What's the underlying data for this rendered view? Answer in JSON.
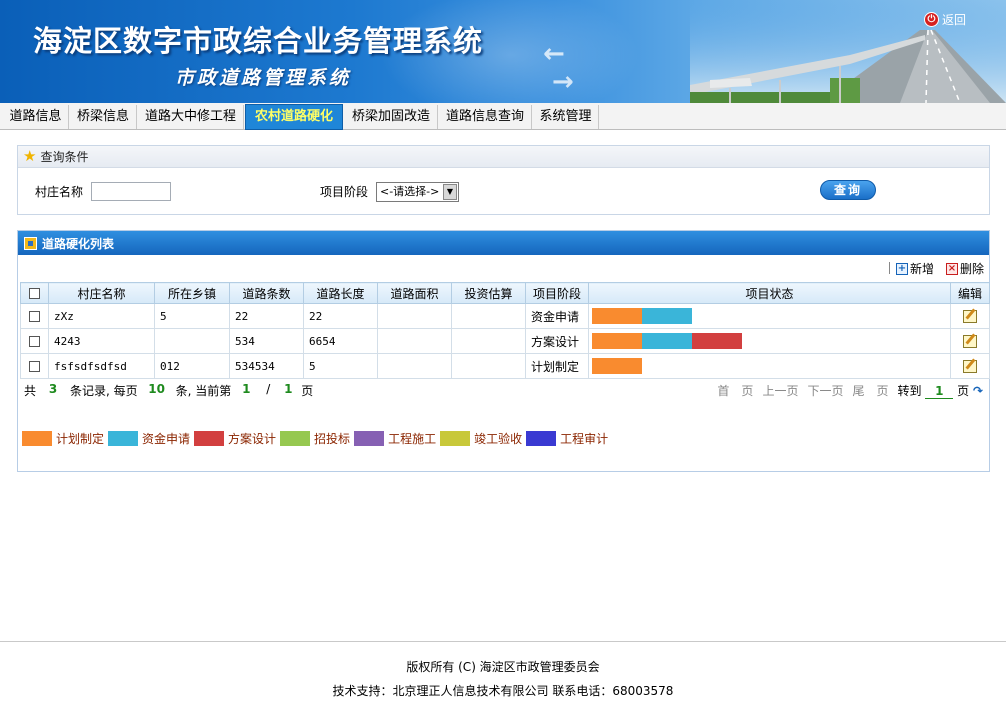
{
  "header": {
    "title": "海淀区数字市政综合业务管理系统",
    "subtitle": "市政道路管理系统",
    "logout_label": "返回"
  },
  "nav": {
    "tabs": [
      {
        "label": "道路信息"
      },
      {
        "label": "桥梁信息"
      },
      {
        "label": "道路大中修工程"
      },
      {
        "label": "农村道路硬化",
        "active": true
      },
      {
        "label": "桥梁加固改造"
      },
      {
        "label": "道路信息查询"
      },
      {
        "label": "系统管理"
      }
    ]
  },
  "query": {
    "title": "查询条件",
    "village_label": "村庄名称",
    "village_value": "",
    "stage_label": "项目阶段",
    "stage_selected": "<-请选择->",
    "search_label": "查询"
  },
  "list": {
    "title": "道路硬化列表",
    "add_label": "新增",
    "delete_label": "删除",
    "columns": [
      "村庄名称",
      "所在乡镇",
      "道路条数",
      "道路长度",
      "道路面积",
      "投资估算",
      "项目阶段",
      "项目状态",
      "编辑"
    ],
    "rows": [
      {
        "village": "zXz",
        "town": "5",
        "road_count": "22",
        "road_length": "22",
        "road_area": "",
        "investment": "",
        "stage": "资金申请",
        "status": [
          "计划制定",
          "资金申请"
        ]
      },
      {
        "village": "4243",
        "town": "",
        "road_count": "534",
        "road_length": "6654",
        "road_area": "",
        "investment": "",
        "stage": "方案设计",
        "status": [
          "计划制定",
          "资金申请",
          "方案设计"
        ]
      },
      {
        "village": "fsfsdfsdfsd",
        "town": "012",
        "road_count": "534534",
        "road_length": "5",
        "road_area": "",
        "investment": "",
        "stage": "计划制定",
        "status": [
          "计划制定"
        ]
      }
    ]
  },
  "pager": {
    "total_prefix": "共",
    "total": "3",
    "records_per": "条记录, 每页",
    "per_page": "10",
    "current_prefix": "条, 当前第",
    "current": "1",
    "slash": "/",
    "pages": "1",
    "page_suffix": "页",
    "first": "首　页",
    "prev": "上一页",
    "next": "下一页",
    "last": "尾　页",
    "goto_label": "转到",
    "goto_value": "1",
    "goto_suffix": "页"
  },
  "legend": [
    {
      "label": "计划制定",
      "color": "#f98b2f"
    },
    {
      "label": "资金申请",
      "color": "#3ab5d9"
    },
    {
      "label": "方案设计",
      "color": "#d23f3f"
    },
    {
      "label": "招投标",
      "color": "#96c850"
    },
    {
      "label": "工程施工",
      "color": "#8660b3"
    },
    {
      "label": "竣工验收",
      "color": "#c8c83a"
    },
    {
      "label": "工程审计",
      "color": "#3a3ad2"
    }
  ],
  "footer": {
    "copyright": "版权所有 (C) 海淀区市政管理委员会",
    "support": "技术支持：北京理正人信息技术有限公司  联系电话：68003578"
  }
}
